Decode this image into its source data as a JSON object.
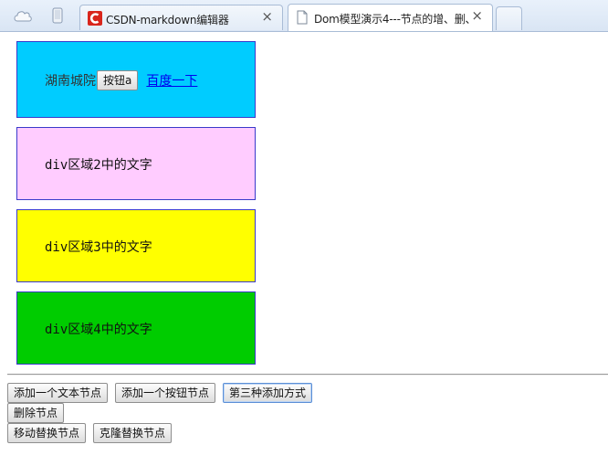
{
  "browser": {
    "tabs": [
      {
        "title": "CSDN-markdown编辑器",
        "close": "×",
        "active": false
      },
      {
        "title": "Dom模型演示4---节点的增、删、",
        "close": "×",
        "active": true
      }
    ]
  },
  "page": {
    "div1": {
      "span_text": "湖南城院",
      "button_label": "按钮a",
      "link_text": "百度一下"
    },
    "div2": {
      "text": "div区域2中的文字"
    },
    "div3": {
      "text": "div区域3中的文字"
    },
    "div4": {
      "text": "div区域4中的文字"
    },
    "buttons": {
      "add_text_node": "添加一个文本节点",
      "add_button_node": "添加一个按钮节点",
      "third_add_method": "第三种添加方式",
      "delete_node": "删除节点",
      "move_replace_node": "移动替换节点",
      "clone_replace_node": "克隆替换节点"
    }
  },
  "colors": {
    "div1_bg": "#00ccff",
    "div2_bg": "#ffccff",
    "div3_bg": "#ffff00",
    "div4_bg": "#00cc00",
    "csdn_brand": "#d9261c"
  },
  "icons": {
    "chrome_left": [
      "cloud-icon",
      "phone-icon"
    ],
    "tab1": "csdn-logo-icon",
    "tab2": "document-icon"
  }
}
